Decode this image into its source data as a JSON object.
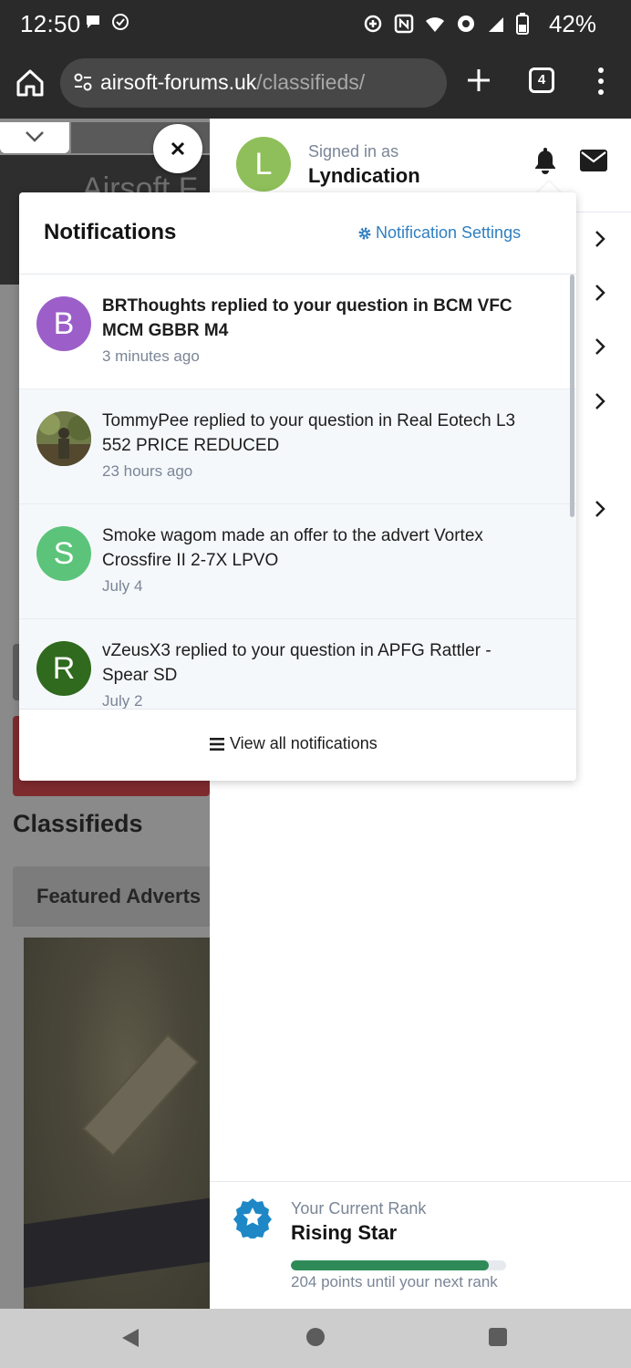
{
  "status_bar": {
    "time": "12:50",
    "battery_percent": "42%",
    "left_icons": [
      "chat-bubble-icon",
      "check-circle-icon"
    ],
    "right_icons": [
      "data-saver-icon",
      "nfc-icon",
      "wifi-icon",
      "hotspot-icon",
      "signal-icon",
      "battery-icon"
    ]
  },
  "browser": {
    "url_host": "airsoft-forums.uk",
    "url_path": "/classifieds/",
    "tab_count": "4"
  },
  "background_page": {
    "brand_text": "Airsoft F",
    "section_title": "Classifieds",
    "featured_label": "Featured Adverts"
  },
  "offcanvas": {
    "user_initial": "L",
    "signed_in_label": "Signed in as",
    "username": "Lyndication",
    "rank": {
      "label": "Your Current Rank",
      "name": "Rising Star",
      "progress_percent": 92,
      "points_text": "204 points until your next rank"
    }
  },
  "notifications": {
    "title": "Notifications",
    "settings_label": "Notification Settings",
    "view_all_label": "View all notifications",
    "items": [
      {
        "initial": "B",
        "text": "BRThoughts replied to your question in BCM VFC MCM GBBR M4",
        "time": "3 minutes ago",
        "unread": true,
        "avatar_color": "#9c5fc9"
      },
      {
        "initial": "",
        "text": "TommyPee replied to your question in Real Eotech L3 552 PRICE REDUCED",
        "time": "23 hours ago",
        "unread": false,
        "avatar_color": "#4f5a35"
      },
      {
        "initial": "S",
        "text": "Smoke wagom made an offer to the advert Vortex Crossfire II 2-7X LPVO",
        "time": "July 4",
        "unread": false,
        "avatar_color": "#5cc47a"
      },
      {
        "initial": "R",
        "text": "vZeusX3 replied to your question in APFG Rattler - Spear SD",
        "time": "July 2",
        "unread": false,
        "avatar_color": "#2f6a1e"
      }
    ]
  },
  "colors": {
    "accent_link": "#2f7fc1",
    "rank_progress": "#2e8b57",
    "rank_badge": "#1e88c7",
    "user_avatar": "#8fbf5a"
  }
}
